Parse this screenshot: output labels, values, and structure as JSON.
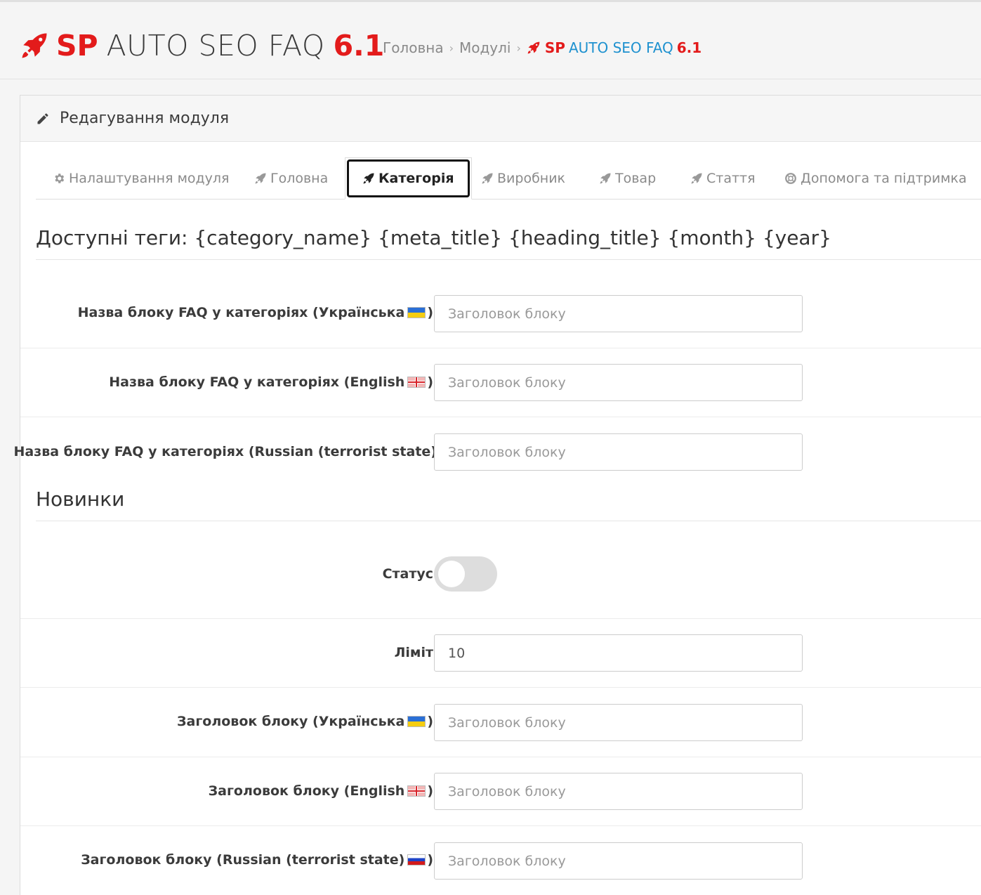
{
  "header": {
    "title_sp": "SP",
    "title_main": "AUTO SEO FAQ",
    "title_version": "6.1",
    "breadcrumb": {
      "home": "Головна",
      "modules": "Модулі",
      "current_sp": "SP",
      "current_main": "AUTO SEO FAQ",
      "current_version": "6.1"
    }
  },
  "panel": {
    "heading": "Редагування модуля"
  },
  "tabs": [
    {
      "label": "Налаштування модуля",
      "icon": "gear-icon"
    },
    {
      "label": "Головна",
      "icon": "rocket-icon"
    },
    {
      "label": "Категорія",
      "icon": "rocket-icon",
      "active": true
    },
    {
      "label": "Виробник",
      "icon": "rocket-icon"
    },
    {
      "label": "Товар",
      "icon": "rocket-icon"
    },
    {
      "label": "Стаття",
      "icon": "rocket-icon"
    },
    {
      "label": "Допомога та підтримка",
      "icon": "lifebuoy-icon"
    }
  ],
  "tags_title": "Доступні теги: {category_name} {meta_title} {heading_title} {month} {year}",
  "faq_block": {
    "rows": [
      {
        "label": "Назва блоку FAQ у категоріях (Українська",
        "label_end": ")",
        "flag": "ua",
        "value": "",
        "placeholder": "Заголовок блоку"
      },
      {
        "label": "Назва блоку FAQ у категоріях (English",
        "label_end": ")",
        "flag": "gb",
        "value": "",
        "placeholder": "Заголовок блоку"
      },
      {
        "label": "Назва блоку FAQ у категоріях (Russian (terrorist state)",
        "label_end": "",
        "flag": "ru",
        "value": "",
        "placeholder": "Заголовок блоку"
      }
    ]
  },
  "news": {
    "title": "Новинки",
    "status_label": "Статус",
    "status_on": false,
    "limit_label": "Ліміт",
    "limit_value": "10",
    "rows": [
      {
        "label": "Заголовок блоку (Українська",
        "label_end": ")",
        "flag": "ua",
        "value": "",
        "placeholder": "Заголовок блоку"
      },
      {
        "label": "Заголовок блоку (English",
        "label_end": ")",
        "flag": "gb",
        "value": "",
        "placeholder": "Заголовок блоку"
      },
      {
        "label": "Заголовок блоку (Russian (terrorist state)",
        "label_end": ")",
        "flag": "ru",
        "value": "",
        "placeholder": "Заголовок блоку"
      }
    ]
  },
  "colors": {
    "brand_red": "#e31b1b",
    "link_blue": "#1e91cf"
  }
}
